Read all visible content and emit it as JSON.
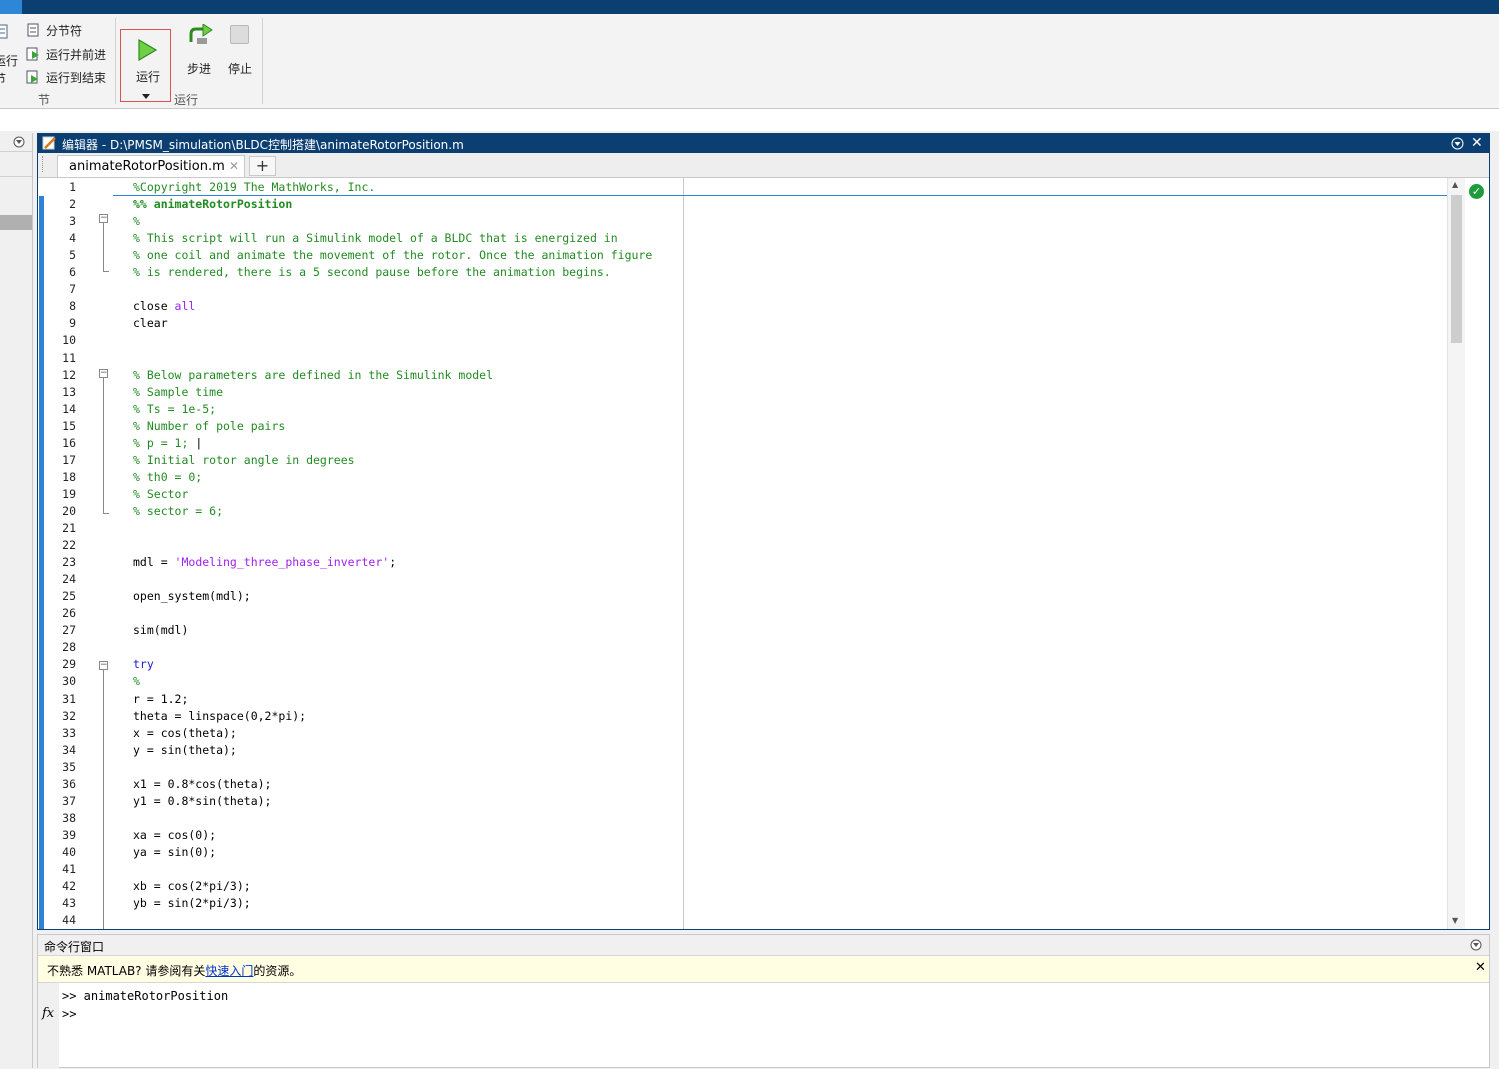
{
  "ribbon": {
    "left_cut": {
      "label1": "运行",
      "label2": "节"
    },
    "section_items": [
      {
        "label": "分节符"
      },
      {
        "label": "运行并前进"
      },
      {
        "label": "运行到结束"
      }
    ],
    "section_group_label": "节",
    "run_button_label": "运行",
    "step_button_label": "步进",
    "stop_button_label": "停止",
    "run_group_label": "运行"
  },
  "editor": {
    "title": "编辑器 - D:\\PMSM_simulation\\BLDC控制搭建\\animateRotorPosition.m",
    "tab_label": "animateRotorPosition.m",
    "add_tab_label": "+",
    "lines": [
      {
        "n": "1",
        "segments": [
          {
            "t": "%Copyright 2019 The MathWorks, Inc.",
            "c": "cm"
          }
        ]
      },
      {
        "n": "2",
        "segments": [
          {
            "t": "%% animateRotorPosition",
            "c": "cm-b"
          }
        ]
      },
      {
        "n": "3",
        "segments": [
          {
            "t": "%",
            "c": "cm"
          }
        ]
      },
      {
        "n": "4",
        "segments": [
          {
            "t": "% This script will run a Simulink model of a BLDC that is energized in",
            "c": "cm"
          }
        ]
      },
      {
        "n": "5",
        "segments": [
          {
            "t": "% one coil and animate the movement of the rotor. Once the animation figure",
            "c": "cm"
          }
        ]
      },
      {
        "n": "6",
        "segments": [
          {
            "t": "% is rendered, there is a 5 second pause before the animation begins.",
            "c": "cm"
          }
        ]
      },
      {
        "n": "7",
        "segments": []
      },
      {
        "n": "8",
        "segments": [
          {
            "t": "close ",
            "c": ""
          },
          {
            "t": "all",
            "c": "str"
          }
        ]
      },
      {
        "n": "9",
        "segments": [
          {
            "t": "clear",
            "c": ""
          }
        ]
      },
      {
        "n": "10",
        "segments": []
      },
      {
        "n": "11",
        "segments": []
      },
      {
        "n": "12",
        "segments": [
          {
            "t": "% Below parameters are defined in the Simulink model",
            "c": "cm"
          }
        ]
      },
      {
        "n": "13",
        "segments": [
          {
            "t": "% Sample time",
            "c": "cm"
          }
        ]
      },
      {
        "n": "14",
        "segments": [
          {
            "t": "% Ts = 1e-5;",
            "c": "cm"
          }
        ]
      },
      {
        "n": "15",
        "segments": [
          {
            "t": "% Number of pole pairs",
            "c": "cm"
          }
        ]
      },
      {
        "n": "16",
        "segments": [
          {
            "t": "% p = 1; ",
            "c": "cm"
          },
          {
            "t": "|",
            "c": ""
          }
        ]
      },
      {
        "n": "17",
        "segments": [
          {
            "t": "% Initial rotor angle in degrees",
            "c": "cm"
          }
        ]
      },
      {
        "n": "18",
        "segments": [
          {
            "t": "% th0 = 0;",
            "c": "cm"
          }
        ]
      },
      {
        "n": "19",
        "segments": [
          {
            "t": "% Sector",
            "c": "cm"
          }
        ]
      },
      {
        "n": "20",
        "segments": [
          {
            "t": "% sector = 6;",
            "c": "cm"
          }
        ]
      },
      {
        "n": "21",
        "segments": []
      },
      {
        "n": "22",
        "segments": []
      },
      {
        "n": "23",
        "segments": [
          {
            "t": "mdl = ",
            "c": ""
          },
          {
            "t": "'Modeling_three_phase_inverter'",
            "c": "str"
          },
          {
            "t": ";",
            "c": ""
          }
        ]
      },
      {
        "n": "24",
        "segments": []
      },
      {
        "n": "25",
        "segments": [
          {
            "t": "open_system(mdl);",
            "c": ""
          }
        ]
      },
      {
        "n": "26",
        "segments": []
      },
      {
        "n": "27",
        "segments": [
          {
            "t": "sim(mdl)",
            "c": ""
          }
        ]
      },
      {
        "n": "28",
        "segments": []
      },
      {
        "n": "29",
        "segments": [
          {
            "t": "try",
            "c": "kw"
          }
        ]
      },
      {
        "n": "30",
        "segments": [
          {
            "t": "%",
            "c": "cm"
          }
        ]
      },
      {
        "n": "31",
        "segments": [
          {
            "t": "r = 1.2;",
            "c": ""
          }
        ]
      },
      {
        "n": "32",
        "segments": [
          {
            "t": "theta = linspace(0,2*pi);",
            "c": ""
          }
        ]
      },
      {
        "n": "33",
        "segments": [
          {
            "t": "x = cos(theta);",
            "c": ""
          }
        ]
      },
      {
        "n": "34",
        "segments": [
          {
            "t": "y = sin(theta);",
            "c": ""
          }
        ]
      },
      {
        "n": "35",
        "segments": []
      },
      {
        "n": "36",
        "segments": [
          {
            "t": "x1 = 0.8*cos(theta);",
            "c": ""
          }
        ]
      },
      {
        "n": "37",
        "segments": [
          {
            "t": "y1 = 0.8*sin(theta);",
            "c": ""
          }
        ]
      },
      {
        "n": "38",
        "segments": []
      },
      {
        "n": "39",
        "segments": [
          {
            "t": "xa = cos(0);",
            "c": ""
          }
        ]
      },
      {
        "n": "40",
        "segments": [
          {
            "t": "ya = sin(0);",
            "c": ""
          }
        ]
      },
      {
        "n": "41",
        "segments": []
      },
      {
        "n": "42",
        "segments": [
          {
            "t": "xb = cos(2*pi/3);",
            "c": ""
          }
        ]
      },
      {
        "n": "43",
        "segments": [
          {
            "t": "yb = sin(2*pi/3);",
            "c": ""
          }
        ]
      },
      {
        "n": "44",
        "segments": []
      }
    ]
  },
  "command_window": {
    "title": "命令行窗口",
    "notice_prefix": "不熟悉 MATLAB? 请参阅有关",
    "notice_link": "快速入门",
    "notice_suffix": "的资源。",
    "history_line": ">> animateRotorPosition",
    "prompt": ">>",
    "fx_label": "fx"
  },
  "colors": {
    "title_bar": "#0b3f72",
    "comment": "#228b22",
    "keyword": "#1b1bd6",
    "string": "#a020f0",
    "run_highlight_border": "#e05050"
  },
  "icons": [
    "run-icon",
    "step-icon",
    "stop-icon",
    "section-break-icon",
    "run-and-advance-icon",
    "run-to-end-icon",
    "edit-icon",
    "collapse-icon",
    "close-icon",
    "status-ok-icon",
    "fx-icon",
    "chevron-down-icon"
  ]
}
